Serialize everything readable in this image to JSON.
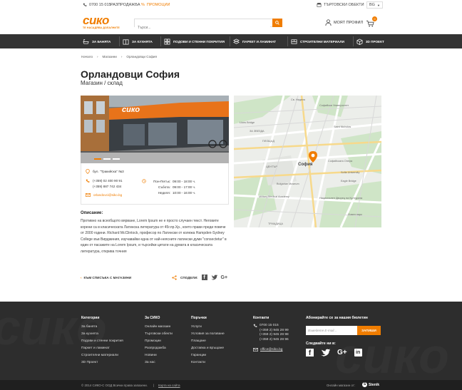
{
  "topbar": {
    "phone": "0700 15 015",
    "sale": "РАЗПРОДАЖБА",
    "promo": "ПРОМОЦИИ",
    "stores": "ТЪРГОВСКИ ОБЕКТИ",
    "lang": "BG"
  },
  "header": {
    "logo_word": "сико",
    "logo_tag": "ТЕ НАСАДЯВА ДОЛАЛНИТЕ",
    "search_placeholder": "Търси...",
    "profile": "МОЯТ ПРОФИЛ",
    "cart_count": "0"
  },
  "nav": {
    "items": [
      "ЗА БАНЯТА",
      "ЗА КУХНЯТА",
      "ПОДОВИ И СТЕННИ ПОКРИТИЯ",
      "ПАРКЕТ И ЛАМИНАТ",
      "СТРОИТЕЛНИ МАТЕРИАЛИ",
      "3D ПРОЕКТ"
    ]
  },
  "breadcrumb": [
    "Начало",
    "Магазини",
    "Орландовци София"
  ],
  "store": {
    "title": "Орландовци София",
    "subtitle": "Магазин / склад",
    "address": "бул. \"Тракийска\" №3",
    "phone1": "(+359) 02 400 90 91",
    "phone2": "(+359) 887 742 434",
    "email": "orlandovci@siko.bg",
    "hours": [
      {
        "day": "Пон-Петък:",
        "time": "09:00 - 18:00 ч."
      },
      {
        "day": "Събота:",
        "time": "09:00 - 17:00 ч."
      },
      {
        "day": "Неделя:",
        "time": "10:00 - 16:00 ч."
      }
    ],
    "photo_sign": "сико"
  },
  "map": {
    "streets": [
      "Св. Неделя",
      "Софийски Университет",
      "Lions Bridge",
      "Saint Nicholas",
      "Bulgarian Museum",
      "Софийската Опера",
      "Sofia University",
      "Eagle Bridge",
      "Military Medical Academy",
      "Национален Дворец на Културата",
      "ЗА ЗВЕЗДА",
      "ПЛОЩАД",
      "ЦЕНТЪР",
      "ТРИАДИЦА",
      "Ловен парк"
    ],
    "city_label": "София"
  },
  "description": {
    "heading": "Описание:",
    "text": "Противно на всеобщото вярване, Lorem Ipsum не е просто случаен текст. Неговите корени са в класическата Латинска литература от 45г.пр.Хр., което прави преди повече от 2000 години. Richard McClintock, професор по Латински от колежа Hampden-Sydney College във Вирджиния, изучавайки една от най-неясните латински думи \"consectetur\" в един от пасажите на Lorem Ipsum, и търсейки цитати на думата в класическата литература, открива точния"
  },
  "actions": {
    "back": "КЪМ СПИСЪКА С МАГАЗИНИ",
    "share": "СПОДЕЛИ:"
  },
  "footer": {
    "col1": {
      "heading": "Категории",
      "items": [
        "За банята",
        "За кухнята",
        "Подови и стенни покрития",
        "Паркет и ламинат",
        "Строителни материали",
        "3D Проект"
      ]
    },
    "col2": {
      "heading": "За СИКО",
      "items": [
        "Онлайн магазин",
        "Търговски обекти",
        "Промоции",
        "Разпродажба",
        "Новини",
        "За нас"
      ]
    },
    "col3": {
      "heading": "Поръчки",
      "items": [
        "Услуги",
        "Условия за ползване",
        "Плащане",
        "Доставка и връщане",
        "Гаранции",
        "Контакти"
      ]
    },
    "col4": {
      "heading": "Контакти",
      "items": [
        "0700 15 015",
        "(+359 2) 945 28 99",
        "(+359 2) 945 28 98",
        "(+359 2) 945 28 96"
      ],
      "email": "office@siko.bg"
    },
    "newsletter_heading": "Абонирайте се за нашия бюлетин",
    "newsletter_placeholder": "Въведете E-mail...",
    "newsletter_button": "ЗАПИШИ",
    "follow_heading": "Следвайте ни в:",
    "copyright": "© 2014 СИКО-С ООД Всички права запазени.",
    "sitemap": "Карта на сайта",
    "credit": "Онлайн магазин от:",
    "credit_brand": "Stenik"
  },
  "colors": {
    "accent": "#f07d00",
    "nav_bg": "#333333",
    "footer_bg": "#2d2d2d"
  }
}
